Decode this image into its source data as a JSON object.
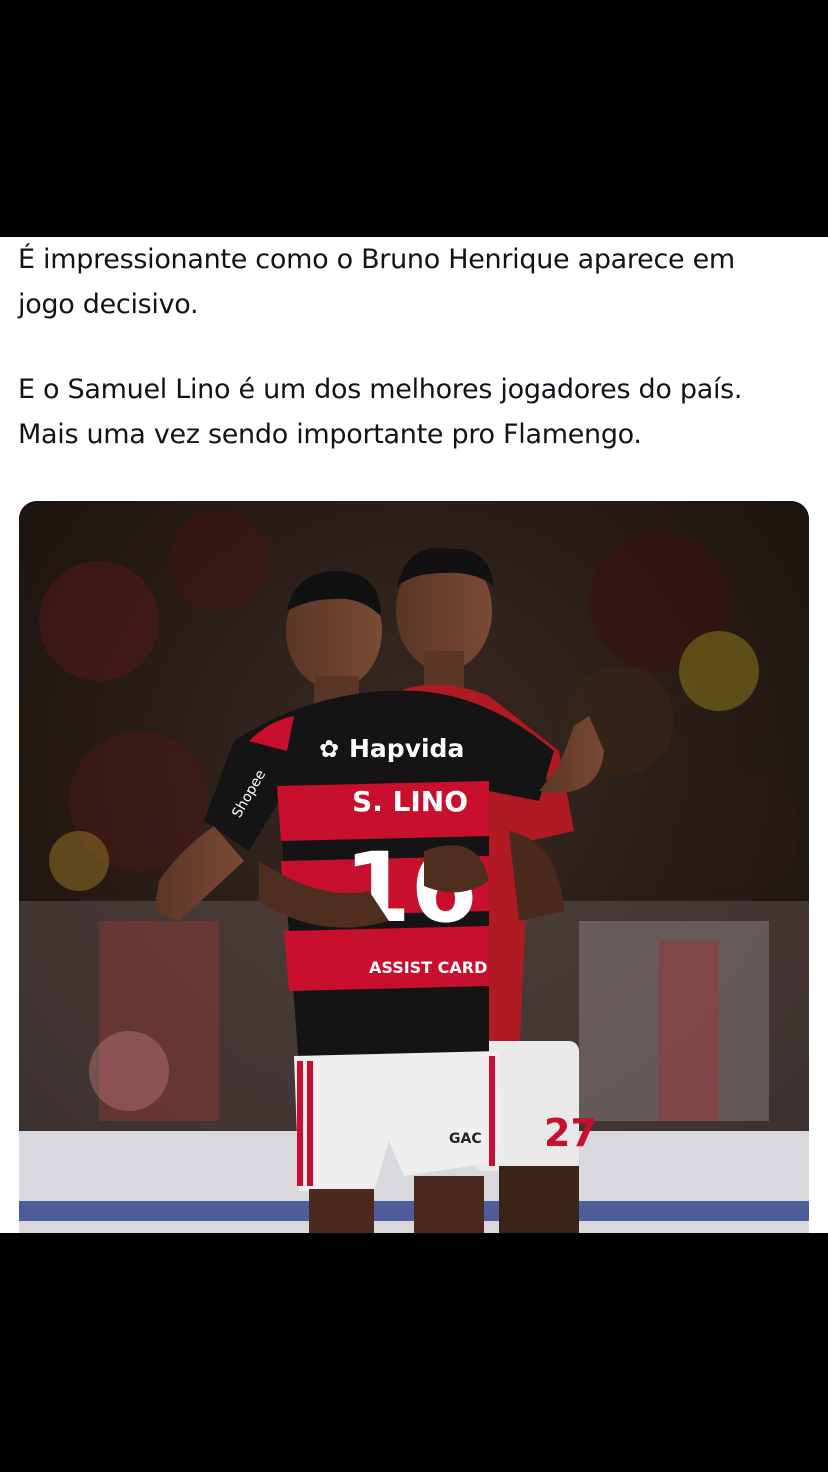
{
  "tweet": {
    "lines": [
      "É impressionante como o Bruno Henrique aparece em",
      "jogo decisivo.",
      "E o Samuel Lino é um dos melhores jogadores do país.",
      "Mais uma vez sendo importante pro Flamengo."
    ]
  },
  "photo": {
    "sponsor_main": "Hapvida",
    "sleeve_sponsor": "Shopee",
    "player_name": "S. LINO",
    "player_number": "16",
    "other_number": "27",
    "lower_sponsor": "ASSIST CARD",
    "shorts_brand": "GAC"
  },
  "colors": {
    "background": "#000000",
    "card": "#ffffff",
    "text": "#0f1419",
    "jersey_red": "#c8102e",
    "jersey_black": "#141414"
  }
}
